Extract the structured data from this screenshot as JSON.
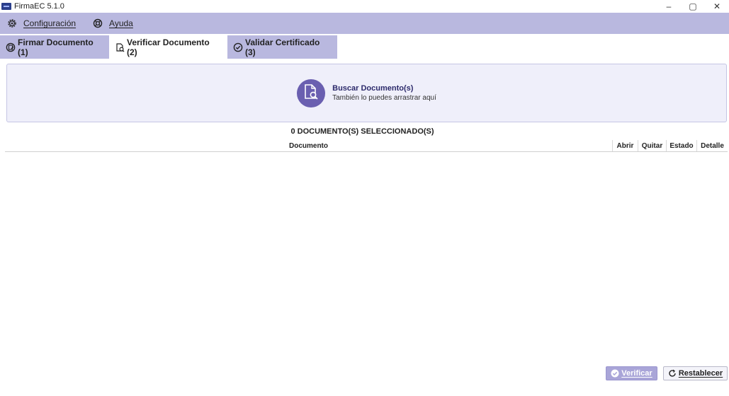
{
  "window": {
    "title": "FirmaEC 5.1.0",
    "controls": {
      "minimize": "–",
      "maximize": "▢",
      "close": "✕"
    }
  },
  "menu": {
    "items": [
      {
        "label": "Configuración",
        "icon": "gear-icon"
      },
      {
        "label": "Ayuda",
        "icon": "help-icon"
      }
    ]
  },
  "tabs": [
    {
      "label": "Firmar Documento (1)",
      "icon": "sign-document-icon",
      "active": false
    },
    {
      "label": "Verificar Documento (2)",
      "icon": "verify-document-icon",
      "active": true
    },
    {
      "label": "Validar Certificado (3)",
      "icon": "check-circle-icon",
      "active": false
    }
  ],
  "dropzone": {
    "title": "Buscar Documento(s)",
    "subtitle": "También lo puedes arrastrar aquí",
    "icon": "document-search-icon"
  },
  "selection": {
    "count_text": "0 DOCUMENTO(S) SELECCIONADO(S)"
  },
  "table": {
    "columns": [
      "Documento",
      "Abrir",
      "Quitar",
      "Estado",
      "Detalle"
    ],
    "rows": []
  },
  "actions": {
    "verify_label": "Verificar",
    "reset_label": "Restablecer"
  },
  "colors": {
    "accent": "#6a5fb0",
    "bar": "#b9b8df",
    "dropzone_bg": "#efeffa"
  }
}
